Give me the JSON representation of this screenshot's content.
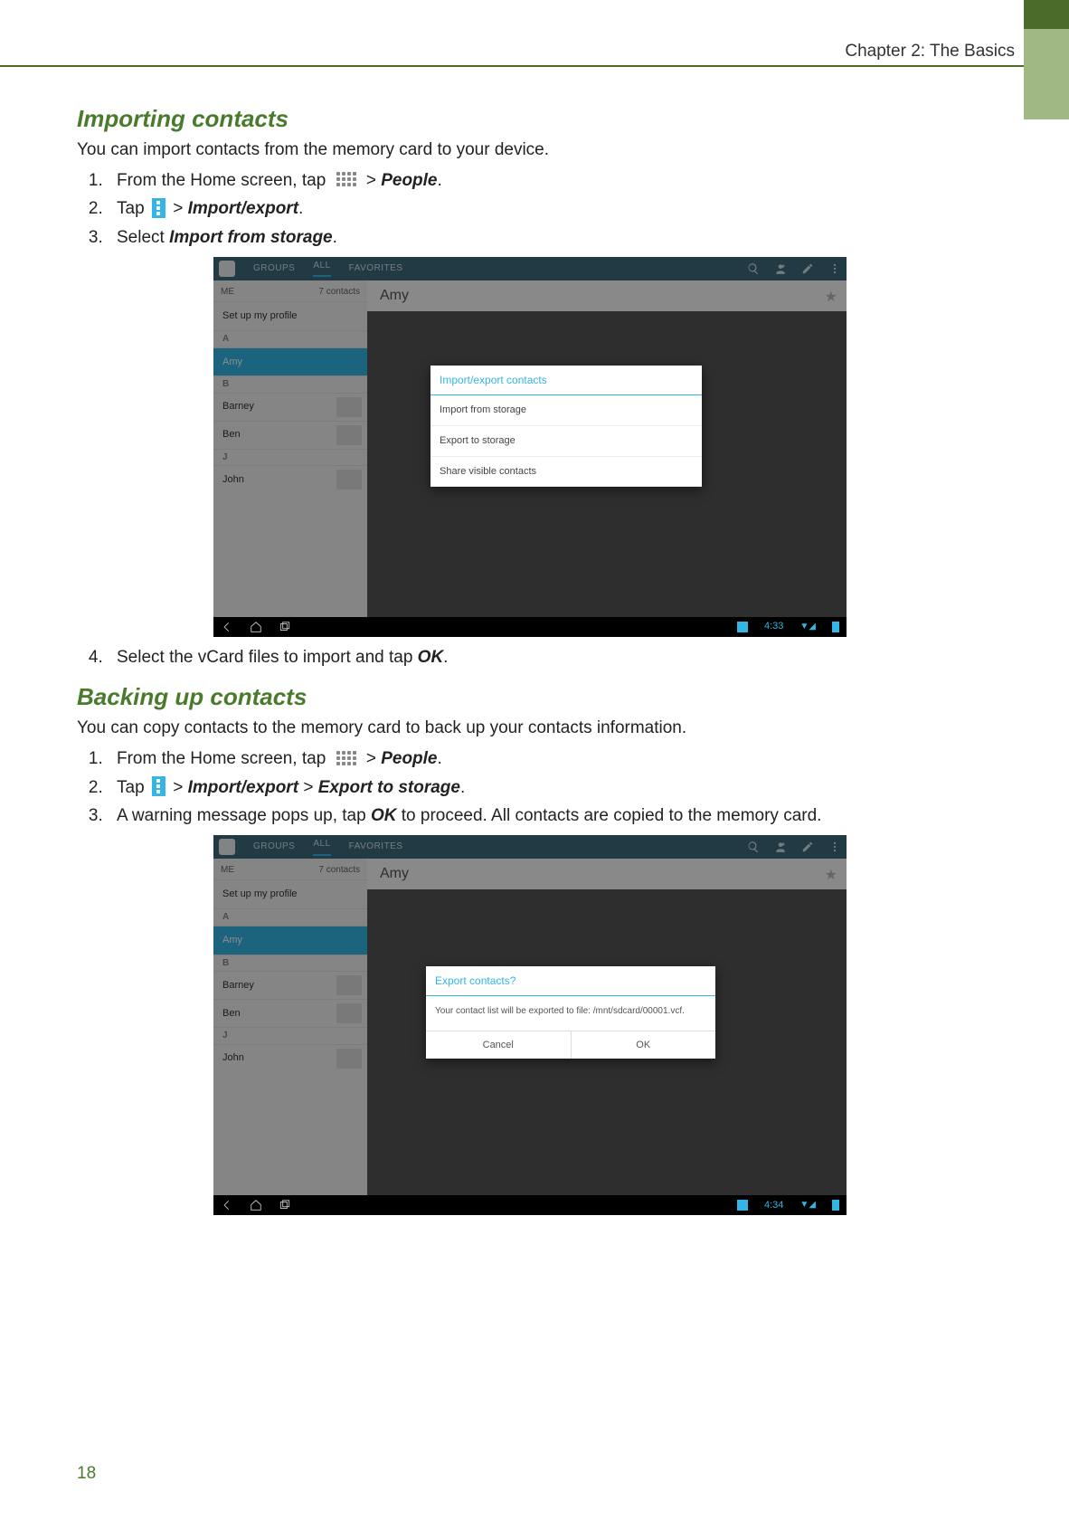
{
  "header": {
    "chapter": "Chapter 2: The Basics"
  },
  "page_number": "18",
  "section1": {
    "title": "Importing contacts",
    "intro": "You can import contacts from the memory card to your device.",
    "steps": {
      "s1a": "From the Home screen, tap ",
      "s1b": " > ",
      "s1_people": "People",
      "s2a": "Tap ",
      "s2b": " > ",
      "s2_importexport": "Import/export",
      "s3a": "Select ",
      "s3_importfrom": "Import from storage",
      "s4a": "Select the vCard files to import and tap ",
      "s4_ok": "OK"
    }
  },
  "section2": {
    "title": "Backing up contacts",
    "intro": "You can copy contacts to the memory card to back up your contacts information.",
    "steps": {
      "s1a": "From the Home screen, tap ",
      "s1b": " > ",
      "s1_people": "People",
      "s2a": "Tap ",
      "s2b": " > ",
      "s2_importexport": "Import/export",
      "s2c": " > ",
      "s2_export": "Export to storage",
      "s3a": "A warning message pops up, tap ",
      "s3_ok": "OK",
      "s3b": " to proceed. All contacts are copied to the memory card."
    }
  },
  "screenshot_common": {
    "tabs": {
      "groups": "GROUPS",
      "all": "ALL",
      "favorites": "FAVORITES"
    },
    "sidebar": {
      "head_left": "ME",
      "head_right": "7 contacts",
      "setup": "Set up my profile",
      "letter_a": "A",
      "amy": "Amy",
      "letter_b": "B",
      "barney": "Barney",
      "ben": "Ben",
      "letter_j": "J",
      "john": "John"
    },
    "detail_name": "Amy",
    "nav_time1": "4:33",
    "nav_time2": "4:34"
  },
  "screenshot1": {
    "popup_title": "Import/export contacts",
    "items": [
      "Import from storage",
      "Export to storage",
      "Share visible contacts"
    ]
  },
  "screenshot2": {
    "popup_title": "Export contacts?",
    "message": "Your contact list will be exported to file: /mnt/sdcard/00001.vcf.",
    "cancel": "Cancel",
    "ok": "OK"
  }
}
